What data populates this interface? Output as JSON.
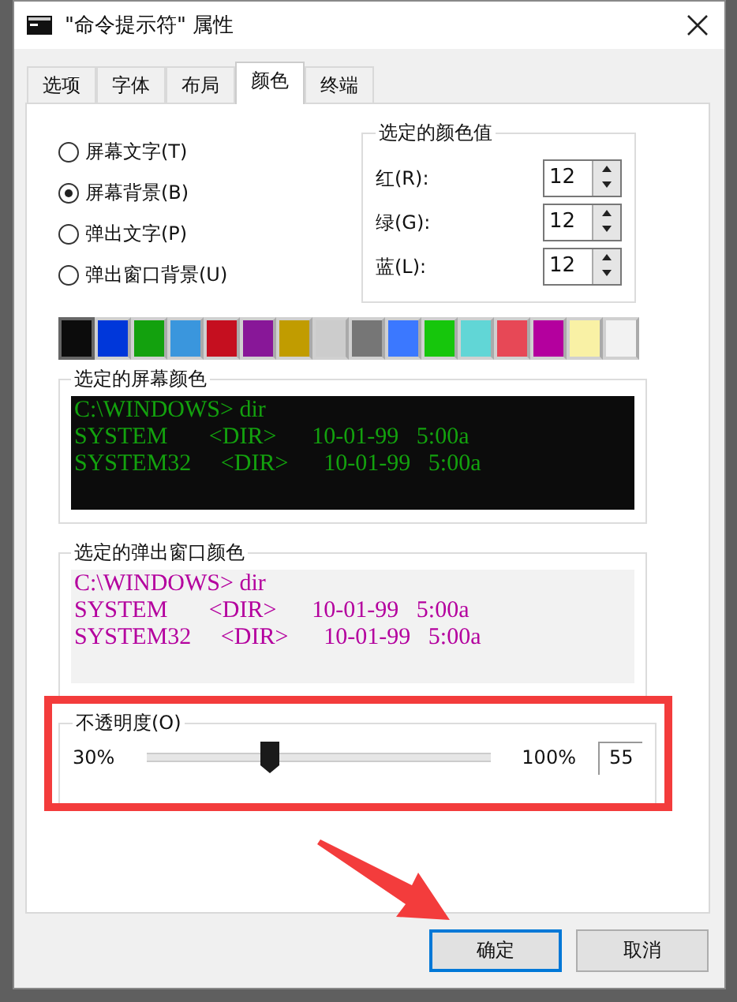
{
  "window": {
    "title": "\"命令提示符\" 属性"
  },
  "tabs": [
    {
      "label": "选项",
      "selected": false
    },
    {
      "label": "字体",
      "selected": false
    },
    {
      "label": "布局",
      "selected": false
    },
    {
      "label": "颜色",
      "selected": true
    },
    {
      "label": "终端",
      "selected": false
    }
  ],
  "radios": [
    {
      "label": "屏幕文字(T)",
      "selected": false
    },
    {
      "label": "屏幕背景(B)",
      "selected": true
    },
    {
      "label": "弹出文字(P)",
      "selected": false
    },
    {
      "label": "弹出窗口背景(U)",
      "selected": false
    }
  ],
  "color_values": {
    "title": "选定的颜色值",
    "fields": [
      {
        "label": "红(R):",
        "value": "12"
      },
      {
        "label": "绿(G):",
        "value": "12"
      },
      {
        "label": "蓝(L):",
        "value": "12"
      }
    ]
  },
  "palette": [
    {
      "color": "#0c0c0c",
      "selected": true
    },
    {
      "color": "#0037da",
      "selected": false
    },
    {
      "color": "#13a10e",
      "selected": false
    },
    {
      "color": "#3a96dd",
      "selected": false
    },
    {
      "color": "#c50f1f",
      "selected": false
    },
    {
      "color": "#881798",
      "selected": false
    },
    {
      "color": "#c19c00",
      "selected": false
    },
    {
      "color": "#cccccc",
      "selected": false
    },
    {
      "color": "#767676",
      "selected": false
    },
    {
      "color": "#3b78ff",
      "selected": false
    },
    {
      "color": "#16c60c",
      "selected": false
    },
    {
      "color": "#61d6d6",
      "selected": false
    },
    {
      "color": "#e74856",
      "selected": false
    },
    {
      "color": "#b4009e",
      "selected": false
    },
    {
      "color": "#f9f1a5",
      "selected": false
    },
    {
      "color": "#f2f2f2",
      "selected": false
    }
  ],
  "screen_preview": {
    "title": "选定的屏幕颜色",
    "color": "#13a10e",
    "background": {
      "color": "#0c0c0c"
    },
    "lines": [
      "C:\\WINDOWS> dir",
      "SYSTEM       <DIR>      10-01-99   5:00a",
      "SYSTEM32     <DIR>      10-01-99   5:00a"
    ]
  },
  "popup_preview": {
    "title": "选定的弹出窗口颜色",
    "color": "#b4009e",
    "background": {
      "color": "#f2f2f2"
    },
    "lines": [
      "C:\\WINDOWS> dir",
      "SYSTEM       <DIR>      10-01-99   5:00a",
      "SYSTEM32     <DIR>      10-01-99   5:00a"
    ]
  },
  "opacity": {
    "label": "不透明度(O)",
    "min_label": "30%",
    "max_label": "100%",
    "value": "55",
    "level": 0.36
  },
  "buttons": [
    {
      "label": "确定",
      "default": true
    },
    {
      "label": "取消",
      "default": false
    }
  ]
}
